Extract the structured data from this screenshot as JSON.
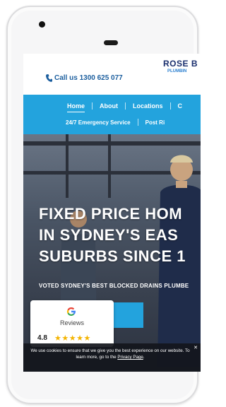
{
  "header": {
    "call_text": "Call us 1300 625 077",
    "logo_top": "ROSE B",
    "logo_bottom": "PLUMBIN"
  },
  "nav": {
    "row1": [
      "Home",
      "About",
      "Locations",
      "C"
    ],
    "row2": [
      "24/7 Emergency Service",
      "Post Ri"
    ]
  },
  "hero": {
    "headline_lines": [
      "FIXED PRICE HOM",
      "IN SYDNEY'S EAS",
      "SUBURBS SINCE 1"
    ],
    "subline": "VOTED SYDNEY'S BEST BLOCKED DRAINS PLUMBE"
  },
  "reviews": {
    "label": "Reviews",
    "rating": "4.8",
    "stars": "★★★★★"
  },
  "cookie": {
    "text_before": "We use cookies to ensure that we give you the best experience on our website. To learn more, go to the ",
    "link": "Privacy Page",
    "text_after": ".",
    "close": "✕"
  },
  "colors": {
    "accent": "#23a3dd",
    "brand_dark": "#1a2f6e",
    "star": "#f4b400"
  }
}
